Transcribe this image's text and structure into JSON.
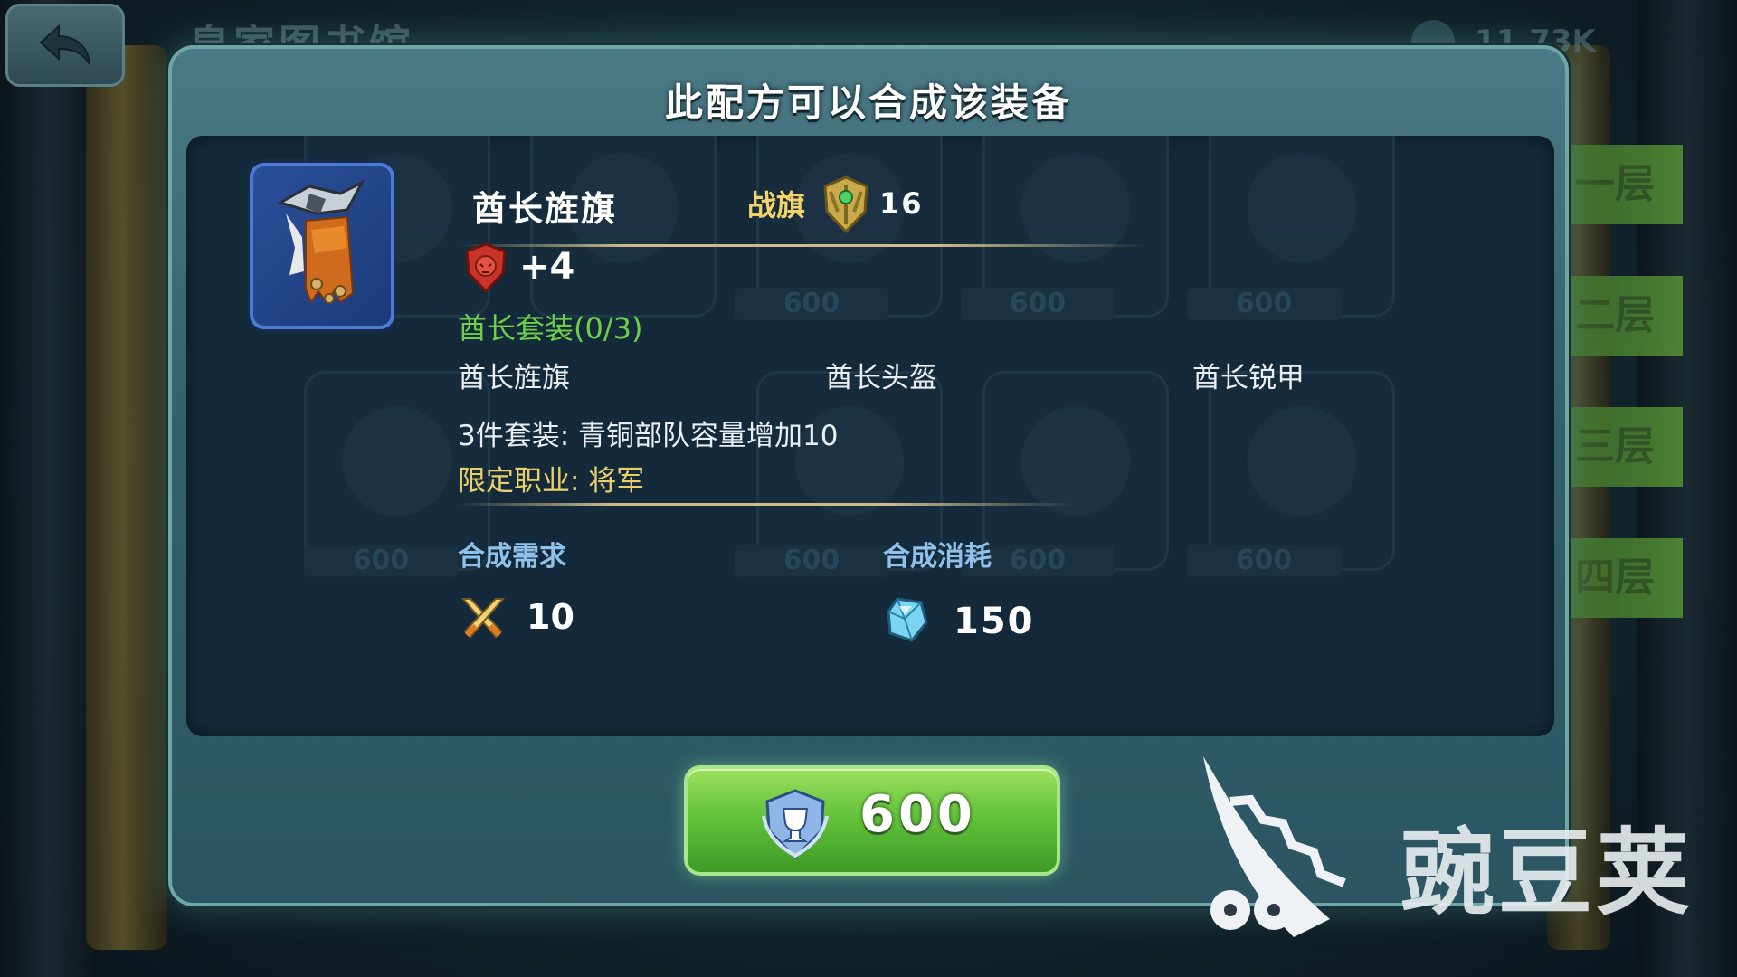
{
  "top_bar": {
    "library_title": "皇家图书馆",
    "currency_amount": "11.73K"
  },
  "floor_tabs": [
    "一层",
    "二层",
    "三层",
    "四层"
  ],
  "background_prices": [
    "600",
    "600",
    "600",
    "600",
    "600",
    "600",
    "600",
    "600"
  ],
  "dialog": {
    "title": "此配方可以合成该装备",
    "item": {
      "name": "酋长旌旗",
      "type": "战旗",
      "level": "16",
      "stat_icon": "lion-crest-icon",
      "stat_value": "+4"
    },
    "set": {
      "title": "酋长套装(0/3)",
      "pieces": [
        "酋长旌旗",
        "酋长头盔",
        "酋长锐甲"
      ],
      "bonus": "3件套装: 青铜部队容量增加10",
      "class_limit": "限定职业: 将军"
    },
    "requirement": {
      "label": "合成需求",
      "icon": "crossed-swords-icon",
      "value": "10"
    },
    "cost": {
      "label": "合成消耗",
      "icon": "blue-crystal-icon",
      "value": "150"
    },
    "confirm_button": {
      "icon": "trophy-medal-icon",
      "price": "600"
    }
  },
  "watermark": {
    "text": "豌豆荚"
  },
  "colors": {
    "set_title": "#6ed04a",
    "class_limit": "#e9d06a",
    "item_type": "#f4d46a",
    "section_label": "#8fc1ea",
    "confirm_button": "#64c33b"
  }
}
